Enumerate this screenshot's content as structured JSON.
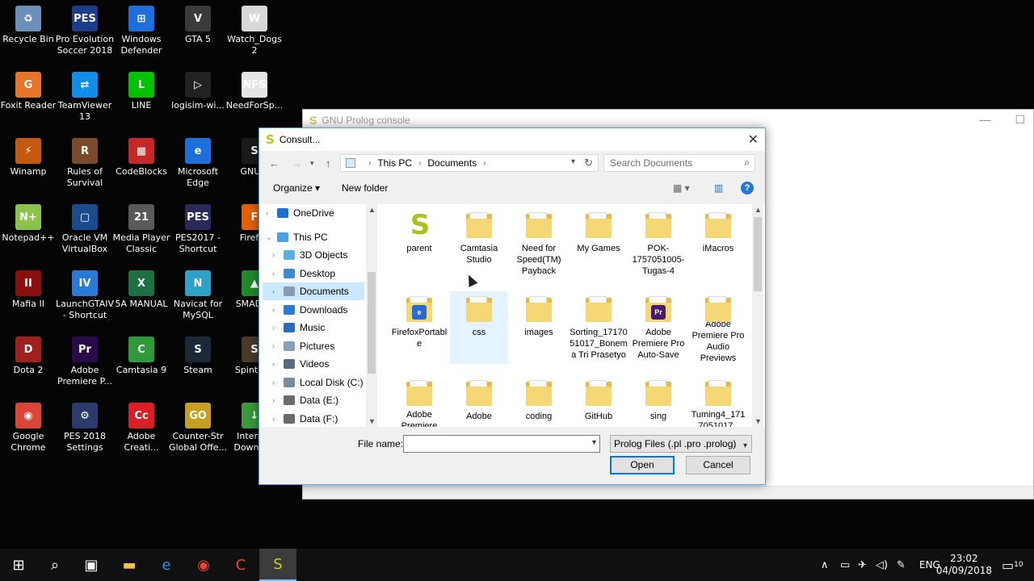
{
  "desktop": {
    "icons": [
      {
        "label": "Recycle Bin",
        "icon": "recycle-bin-icon",
        "color": "#6b8fb8",
        "glyph": "♻"
      },
      {
        "label": "Pro Evolution Soccer 2018",
        "icon": "pes2018-icon",
        "color": "#1d3c8a",
        "glyph": "PES"
      },
      {
        "label": "Windows Defender",
        "icon": "windows-defender-icon",
        "color": "#1e6fd9",
        "glyph": "⊞"
      },
      {
        "label": "GTA 5",
        "icon": "gta5-icon",
        "color": "#3a3a3a",
        "glyph": "V"
      },
      {
        "label": "Watch_Dogs 2",
        "icon": "watchdogs2-icon",
        "color": "#d8d8d8",
        "glyph": "W"
      },
      {
        "label": "Foxit Reader",
        "icon": "foxit-reader-icon",
        "color": "#e8732a",
        "glyph": "G"
      },
      {
        "label": "TeamViewer 13",
        "icon": "teamviewer-icon",
        "color": "#0e8ee9",
        "glyph": "⇄"
      },
      {
        "label": "LINE",
        "icon": "line-icon",
        "color": "#00c300",
        "glyph": "L"
      },
      {
        "label": "logisim-wi...",
        "icon": "logisim-icon",
        "color": "#222222",
        "glyph": "▷"
      },
      {
        "label": "NeedForSp...",
        "icon": "needforspeed-icon",
        "color": "#e5e5e5",
        "glyph": "NFS"
      },
      {
        "label": "Winamp",
        "icon": "winamp-icon",
        "color": "#c45a10",
        "glyph": "⚡"
      },
      {
        "label": "Rules of Survival",
        "icon": "rules-of-survival-icon",
        "color": "#7a4a2a",
        "glyph": "R"
      },
      {
        "label": "CodeBlocks",
        "icon": "codeblocks-icon",
        "color": "#c62828",
        "glyph": "▦"
      },
      {
        "label": "Microsoft Edge",
        "icon": "edge-icon",
        "color": "#1e6fd9",
        "glyph": "e"
      },
      {
        "label": "GNU P",
        "icon": "gnu-prolog-icon",
        "color": "#1a1a1a",
        "glyph": "S"
      },
      {
        "label": "Notepad++",
        "icon": "notepadpp-icon",
        "color": "#8bc34a",
        "glyph": "N+"
      },
      {
        "label": "Oracle VM VirtualBox",
        "icon": "virtualbox-icon",
        "color": "#1a4b8c",
        "glyph": "▢"
      },
      {
        "label": "Media Player Classic",
        "icon": "media-player-classic-icon",
        "color": "#5a5a5a",
        "glyph": "21"
      },
      {
        "label": "PES2017 - Shortcut",
        "icon": "pes2017-icon",
        "color": "#2a2a5a",
        "glyph": "PES"
      },
      {
        "label": "Firefox",
        "icon": "firefox-icon",
        "color": "#e66000",
        "glyph": "F"
      },
      {
        "label": "Mafia II",
        "icon": "mafia2-icon",
        "color": "#8a1010",
        "glyph": "II"
      },
      {
        "label": "LaunchGTAIV - Shortcut",
        "icon": "launch-gtaiv-icon",
        "color": "#2a7ad8",
        "glyph": "IV"
      },
      {
        "label": "5A MANUAL",
        "icon": "excel-file-icon",
        "color": "#1d7044",
        "glyph": "X"
      },
      {
        "label": "Navicat for MySQL",
        "icon": "navicat-icon",
        "color": "#2fa0c8",
        "glyph": "N"
      },
      {
        "label": "SMADAV",
        "icon": "smadav-icon",
        "color": "#1f8a2a",
        "glyph": "▲"
      },
      {
        "label": "Dota 2",
        "icon": "dota2-icon",
        "color": "#a02020",
        "glyph": "D"
      },
      {
        "label": "Adobe Premiere P...",
        "icon": "premiere-icon",
        "color": "#2a0a4a",
        "glyph": "Pr"
      },
      {
        "label": "Camtasia 9",
        "icon": "camtasia-icon",
        "color": "#2e9a3a",
        "glyph": "C"
      },
      {
        "label": "Steam",
        "icon": "steam-icon",
        "color": "#1b2838",
        "glyph": "S"
      },
      {
        "label": "Spintires",
        "icon": "spintires-icon",
        "color": "#4a3a2a",
        "glyph": "S"
      },
      {
        "label": "Google Chrome",
        "icon": "chrome-icon",
        "color": "#db4437",
        "glyph": "◉"
      },
      {
        "label": "PES 2018 Settings",
        "icon": "pes2018-settings-icon",
        "color": "#2a3a6a",
        "glyph": "⚙"
      },
      {
        "label": "Adobe Creati...",
        "icon": "adobe-cc-icon",
        "color": "#da1f26",
        "glyph": "Cc"
      },
      {
        "label": "Counter-Str Global Offe...",
        "icon": "csgo-icon",
        "color": "#c8a020",
        "glyph": "GO"
      },
      {
        "label": "Internet Downlo...",
        "icon": "idm-icon",
        "color": "#3a9a3a",
        "glyph": "↓"
      }
    ]
  },
  "console": {
    "title": "GNU Prolog console",
    "minimize": "—",
    "maximize": "☐"
  },
  "dialog": {
    "title": "Consult...",
    "close": "✕",
    "address": {
      "crumbs": [
        "This PC",
        "Documents"
      ]
    },
    "search_placeholder": "Search Documents",
    "toolbar": {
      "organize": "Organize ▾",
      "new_folder": "New folder",
      "help": "?"
    },
    "nav": [
      {
        "label": "OneDrive",
        "icon": "onedrive-icon",
        "color": "#1f6fd0",
        "indent": 0
      },
      {
        "label": "This PC",
        "icon": "this-pc-icon",
        "color": "#4aa0e0",
        "indent": 0
      },
      {
        "label": "3D Objects",
        "icon": "3d-objects-icon",
        "color": "#5ab0e0",
        "indent": 1
      },
      {
        "label": "Desktop",
        "icon": "desktop-icon",
        "color": "#3a8ad8",
        "indent": 1
      },
      {
        "label": "Documents",
        "icon": "documents-icon",
        "color": "#8a9ab0",
        "indent": 1
      },
      {
        "label": "Downloads",
        "icon": "downloads-icon",
        "color": "#2a7ad0",
        "indent": 1
      },
      {
        "label": "Music",
        "icon": "music-icon",
        "color": "#2a6ab8",
        "indent": 1
      },
      {
        "label": "Pictures",
        "icon": "pictures-icon",
        "color": "#8aa0b8",
        "indent": 1
      },
      {
        "label": "Videos",
        "icon": "videos-icon",
        "color": "#5a6a80",
        "indent": 1
      },
      {
        "label": "Local Disk (C:)",
        "icon": "local-disk-icon",
        "color": "#7a8a9a",
        "indent": 1
      },
      {
        "label": "Data (E:)",
        "icon": "drive-e-icon",
        "color": "#6a6a6a",
        "indent": 1
      },
      {
        "label": "Data (F:)",
        "icon": "drive-f-icon",
        "color": "#6a6a6a",
        "indent": 1
      }
    ],
    "selected_nav": "Documents",
    "files": [
      {
        "label": "parent",
        "icon": "prolog-file-icon",
        "badge": "S",
        "badge_color": "#b8c21e"
      },
      {
        "label": "Camtasia Studio",
        "icon": "folder-icon",
        "badge": "",
        "badge_color": ""
      },
      {
        "label": "Need for Speed(TM) Payback",
        "icon": "folder-icon",
        "badge": "",
        "badge_color": ""
      },
      {
        "label": "My Games",
        "icon": "folder-icon",
        "badge": "",
        "badge_color": ""
      },
      {
        "label": "POK-1757051005-Tugas-4",
        "icon": "folder-icon",
        "badge": "",
        "badge_color": ""
      },
      {
        "label": "iMacros",
        "icon": "folder-icon",
        "badge": "",
        "badge_color": ""
      },
      {
        "label": "FirefoxPortable",
        "icon": "folder-icon",
        "badge": "e",
        "badge_color": "#2a6ad0"
      },
      {
        "label": "css",
        "icon": "folder-icon",
        "badge": "",
        "badge_color": ""
      },
      {
        "label": "images",
        "icon": "folder-icon",
        "badge": "",
        "badge_color": "#2a8ab0"
      },
      {
        "label": "Sorting_1717051017_Bonema Tri Prasetyo",
        "icon": "folder-icon",
        "badge": "",
        "badge_color": ""
      },
      {
        "label": "Adobe Premiere Pro Auto-Save",
        "icon": "folder-icon",
        "badge": "Pr",
        "badge_color": "#4a1a6a"
      },
      {
        "label": "Adobe Premiere Pro Audio Previews",
        "icon": "folder-icon",
        "badge": "",
        "badge_color": ""
      },
      {
        "label": "Adobe Premiere",
        "icon": "folder-icon",
        "badge": "",
        "badge_color": ""
      },
      {
        "label": "Adobe",
        "icon": "folder-icon",
        "badge": "",
        "badge_color": ""
      },
      {
        "label": "coding",
        "icon": "folder-icon",
        "badge": "",
        "badge_color": ""
      },
      {
        "label": "GitHub",
        "icon": "folder-icon",
        "badge": "",
        "badge_color": ""
      },
      {
        "label": "sing",
        "icon": "folder-icon",
        "badge": "",
        "badge_color": ""
      },
      {
        "label": "Tuming4_1717051017_",
        "icon": "folder-icon",
        "badge": "",
        "badge_color": ""
      }
    ],
    "hovered_file": "css",
    "file_name_label": "File name:",
    "file_name_value": "",
    "file_type": "Prolog Files (.pl .pro .prolog)",
    "open_label": "Open",
    "cancel_label": "Cancel"
  },
  "taskbar": {
    "language": "ENG",
    "time": "23:02",
    "date": "04/09/2018",
    "notifications": "10",
    "apps": [
      {
        "icon": "start-icon",
        "glyph": "⊞"
      },
      {
        "icon": "search-icon",
        "glyph": "⌕"
      },
      {
        "icon": "task-view-icon",
        "glyph": "▣"
      },
      {
        "icon": "file-explorer-icon",
        "glyph": "▬"
      },
      {
        "icon": "edge-taskbar-icon",
        "glyph": "e"
      },
      {
        "icon": "chrome-taskbar-icon",
        "glyph": "◉"
      },
      {
        "icon": "camtasia-taskbar-icon",
        "glyph": "C"
      },
      {
        "icon": "gnu-prolog-taskbar-icon",
        "glyph": "S"
      }
    ]
  }
}
